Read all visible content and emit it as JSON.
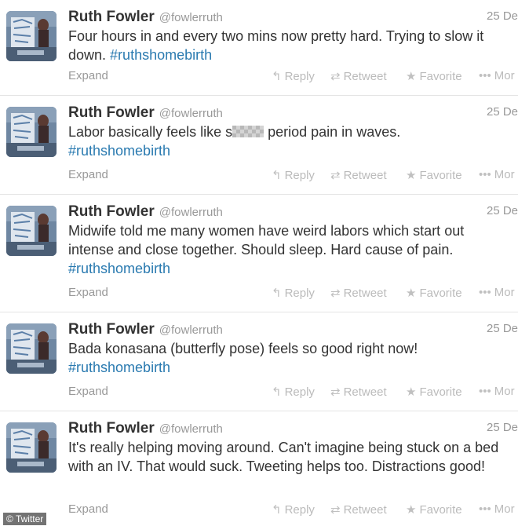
{
  "tweets": [
    {
      "name": "Ruth Fowler",
      "handle": "@fowlerruth",
      "time": "25 De",
      "text_parts": [
        "Four hours in and every two mins now pretty hard. Trying to slow it down. "
      ],
      "hashtag": "#ruthshomebirth",
      "expand": "Expand"
    },
    {
      "name": "Ruth Fowler",
      "handle": "@fowlerruth",
      "time": "25 De",
      "text_parts": [
        "Labor basically feels like s",
        " period pain in waves."
      ],
      "hashtag": "#ruthshomebirth",
      "expand": "Expand"
    },
    {
      "name": "Ruth Fowler",
      "handle": "@fowlerruth",
      "time": "25 De",
      "text_parts": [
        "Midwife told me many women have weird labors which start out intense and close together. Should sleep. Hard cause of pain."
      ],
      "hashtag": "#ruthshomebirth",
      "expand": "Expand"
    },
    {
      "name": "Ruth Fowler",
      "handle": "@fowlerruth",
      "time": "25 De",
      "text_parts": [
        "Bada konasana (butterfly pose) feels so good right now!"
      ],
      "hashtag": "#ruthshomebirth",
      "expand": "Expand"
    },
    {
      "name": "Ruth Fowler",
      "handle": "@fowlerruth",
      "time": "25 De",
      "text_parts": [
        "It's really helping moving around. Can't imagine being stuck on a bed with an IV. That would suck. Tweeting helps too. Distractions good!"
      ],
      "hashtag": "",
      "expand": "Expand"
    }
  ],
  "actions": {
    "reply": "Reply",
    "retweet": "Retweet",
    "favorite": "Favorite",
    "more": "Mor"
  },
  "watermark": "© Twitter",
  "colors": {
    "hashtag": "#2a7ab0",
    "name": "#333333",
    "muted": "#999999"
  }
}
